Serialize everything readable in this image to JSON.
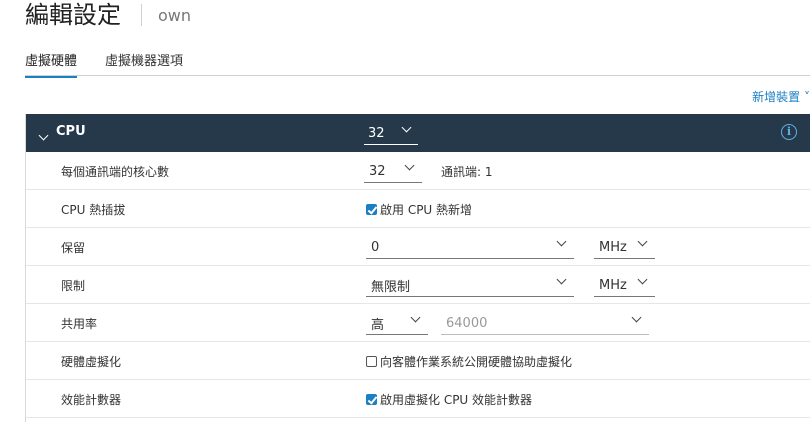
{
  "header": {
    "title": "編輯設定",
    "subtitle": "own"
  },
  "tabs": [
    {
      "label": "虛擬硬體",
      "active": true
    },
    {
      "label": "虛擬機器選項",
      "active": false
    }
  ],
  "add_device_label": "新增裝置 ˅",
  "cpu": {
    "label": "CPU",
    "value": "32",
    "info_symbol": "i"
  },
  "rows": {
    "cores": {
      "label": "每個通訊端的核心數",
      "value": "32",
      "sockets_text": "通訊端: 1"
    },
    "hotplug": {
      "label": "CPU 熱插拔",
      "checkbox_label": "啟用 CPU 熱新增",
      "checked": true
    },
    "reservation": {
      "label": "保留",
      "value": "0",
      "unit": "MHz"
    },
    "limit": {
      "label": "限制",
      "value": "無限制",
      "unit": "MHz"
    },
    "shares": {
      "label": "共用率",
      "level": "高",
      "value": "64000"
    },
    "hw_virt": {
      "label": "硬體虛擬化",
      "checkbox_label": "向客體作業系統公開硬體協助虛擬化",
      "checked": false
    },
    "perf_counters": {
      "label": "效能計數器",
      "checkbox_label": "啟用虛擬化 CPU 效能計數器",
      "checked": true
    }
  },
  "colors": {
    "accent": "#1a7fc3",
    "header_bg": "#25394b",
    "info": "#5fb3e6"
  }
}
